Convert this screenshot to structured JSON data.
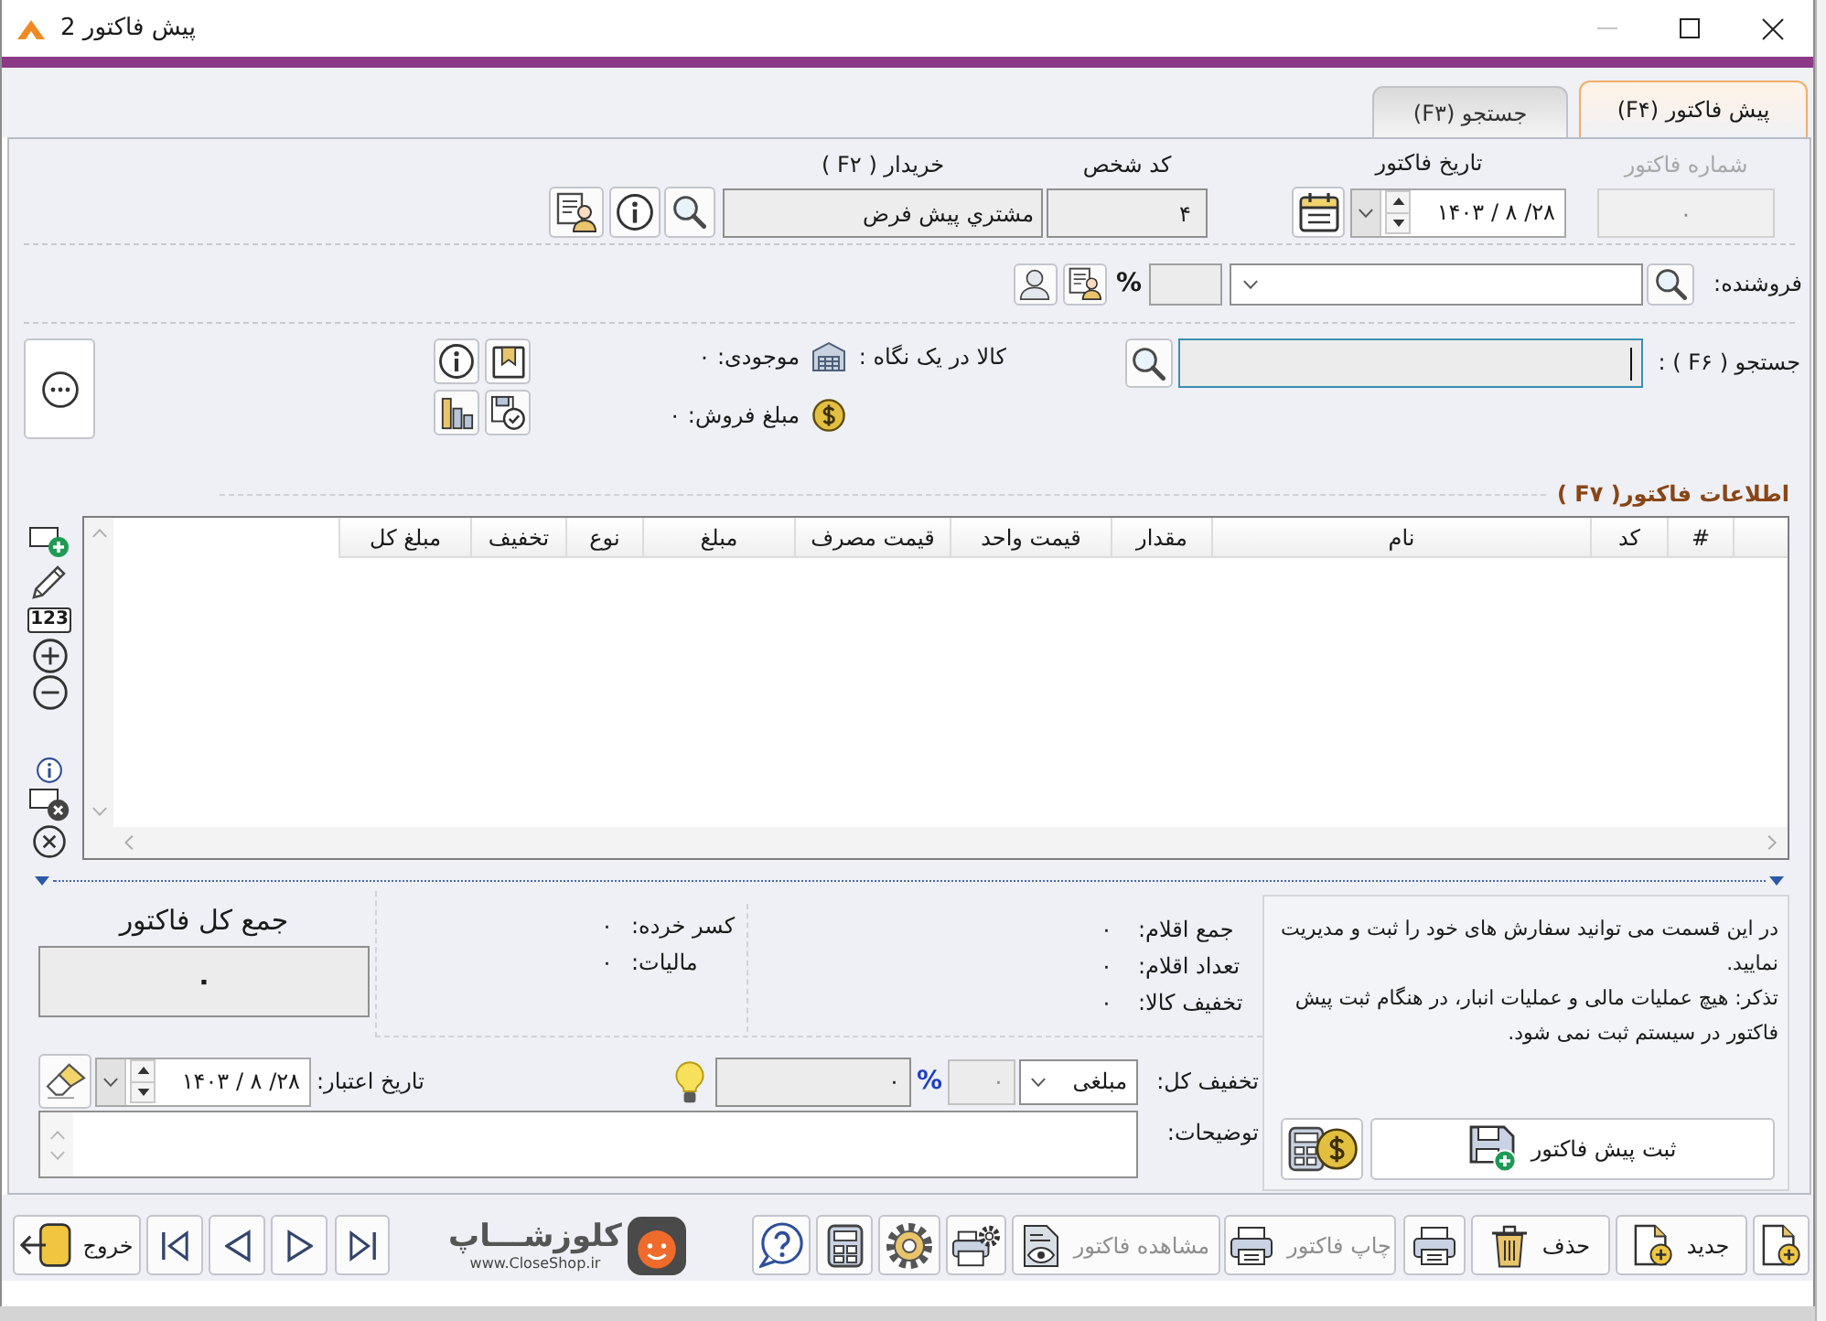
{
  "window": {
    "title": "پیش فاکتور 2",
    "controls": [
      {
        "kind": "minimize",
        "disabled": true
      },
      {
        "kind": "maximize",
        "disabled": false
      },
      {
        "kind": "close",
        "disabled": false
      }
    ]
  },
  "tabs": [
    {
      "label": "پیش فاکتور (F۴)",
      "selected": true
    },
    {
      "label": "جستجو (F۳)",
      "selected": false
    }
  ],
  "header": {
    "invoice_number": {
      "label": "شماره فاکتور",
      "value": "۰",
      "disabled": true
    },
    "invoice_date": {
      "label": "تاریخ فاکتور",
      "value": "۲۸/ ۸ / ۱۴۰۳"
    },
    "person_code": {
      "label": "کد شخص",
      "value": "۴"
    },
    "buyer": {
      "label": "خریدار ( F۲ )",
      "value": "مشتري پیش فرض"
    }
  },
  "seller": {
    "label": "فروشنده:",
    "percent_sign": "%"
  },
  "product_search": {
    "label": "جستجو ( F۶ ) :",
    "focused": true
  },
  "at_a_glance": {
    "title": "کالا در یک نگاه :",
    "stock": "موجودی: ۰",
    "sale_price": "مبلغ فروش: ۰"
  },
  "row_tools": {
    "numbering_label": "123"
  },
  "invoice_items": {
    "title": "اطلاعات فاکتور( F۷ )",
    "columns": [
      "#",
      "کد",
      "نام",
      "مقدار",
      "قیمت واحد",
      "قیمت مصرف",
      "مبلغ",
      "نوع",
      "تخفیف",
      "مبلغ کل"
    ]
  },
  "totals": {
    "summary": [
      {
        "label": "جمع اقلام:",
        "value": "۰"
      },
      {
        "label": "تعداد اقلام:",
        "value": "۰"
      },
      {
        "label": "تخفیف کالا:",
        "value": "۰"
      }
    ],
    "extras": [
      {
        "label": "کسر خرده:",
        "value": "۰"
      },
      {
        "label": "مالیات:",
        "value": "۰"
      }
    ],
    "grand_total": {
      "title": "جمع کل فاکتور",
      "value": "۰"
    }
  },
  "discount": {
    "label": "تخفیف کل:",
    "type": "مبلغی",
    "percent": "۰",
    "percent_sign": "%",
    "amount": "۰"
  },
  "validity_date": {
    "label": "تاریخ اعتبار:",
    "value": "۲۸/ ۸ / ۱۴۰۳"
  },
  "notes": {
    "label": "توضیحات:"
  },
  "info": {
    "paragraphs": [
      "در این قسمت می توانید سفارش های خود را ثبت و مدیریت نمایید.",
      "تذکر: هیچ عملیات مالی و عملیات انبار، در هنگام ثبت پیش فاکتور در سیستم ثبت نمی شود."
    ]
  },
  "save_button": {
    "label": "ثبت پیش فاکتور"
  },
  "toolbar": {
    "buttons": [
      {
        "label": "جدید",
        "disabled": false
      },
      {
        "label": "حذف",
        "disabled": false
      },
      {
        "label": "چاپ فاکتور",
        "disabled": true
      },
      {
        "label": "مشاهده فاکتور",
        "disabled": true
      }
    ],
    "logo": {
      "name": "کلوزشـــاپ",
      "url": "www.CloseShop.ir"
    },
    "exit": {
      "label": "خروج"
    }
  }
}
